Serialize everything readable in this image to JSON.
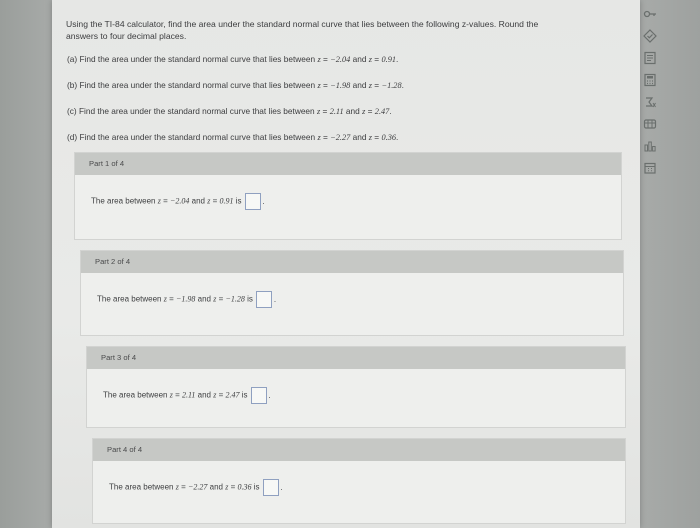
{
  "question": {
    "intro_line1": "Using the TI-84 calculator, find the area under the standard normal curve that lies between the following z-values. Round the",
    "intro_line2": "answers to four decimal places.",
    "items": [
      {
        "label": "(a) Find the area under the standard normal curve that lies between",
        "z1": "−2.04",
        "z2": "0.91"
      },
      {
        "label": "(b) Find the area under the standard normal curve that lies between",
        "z1": "−1.98",
        "z2": "−1.28"
      },
      {
        "label": "(c) Find the area under the standard normal curve that lies between",
        "z1": "2.11",
        "z2": "2.47"
      },
      {
        "label": "(d) Find the area under the standard normal curve that lies between",
        "z1": "−2.27",
        "z2": "0.36"
      }
    ]
  },
  "parts": [
    {
      "header": "Part 1 of 4",
      "prefix": "The area between",
      "z1": "−2.04",
      "z2": "0.91",
      "suffix": "is"
    },
    {
      "header": "Part 2 of 4",
      "prefix": "The area between",
      "z1": "−1.98",
      "z2": "−1.28",
      "suffix": "is"
    },
    {
      "header": "Part 3 of 4",
      "prefix": "The area between",
      "z1": "2.11",
      "z2": "2.47",
      "suffix": "is"
    },
    {
      "header": "Part 4 of 4",
      "prefix": "The area between",
      "z1": "−2.27",
      "z2": "0.36",
      "suffix": "is"
    }
  ],
  "common": {
    "z_var": "z",
    "equals": "=",
    "and": "and",
    "period": "."
  },
  "toolbar": {
    "icons": [
      "key-icon",
      "check-icon",
      "notes-icon",
      "calculator-icon",
      "formula-icon",
      "table-icon",
      "chart-icon",
      "calendar-icon"
    ]
  }
}
